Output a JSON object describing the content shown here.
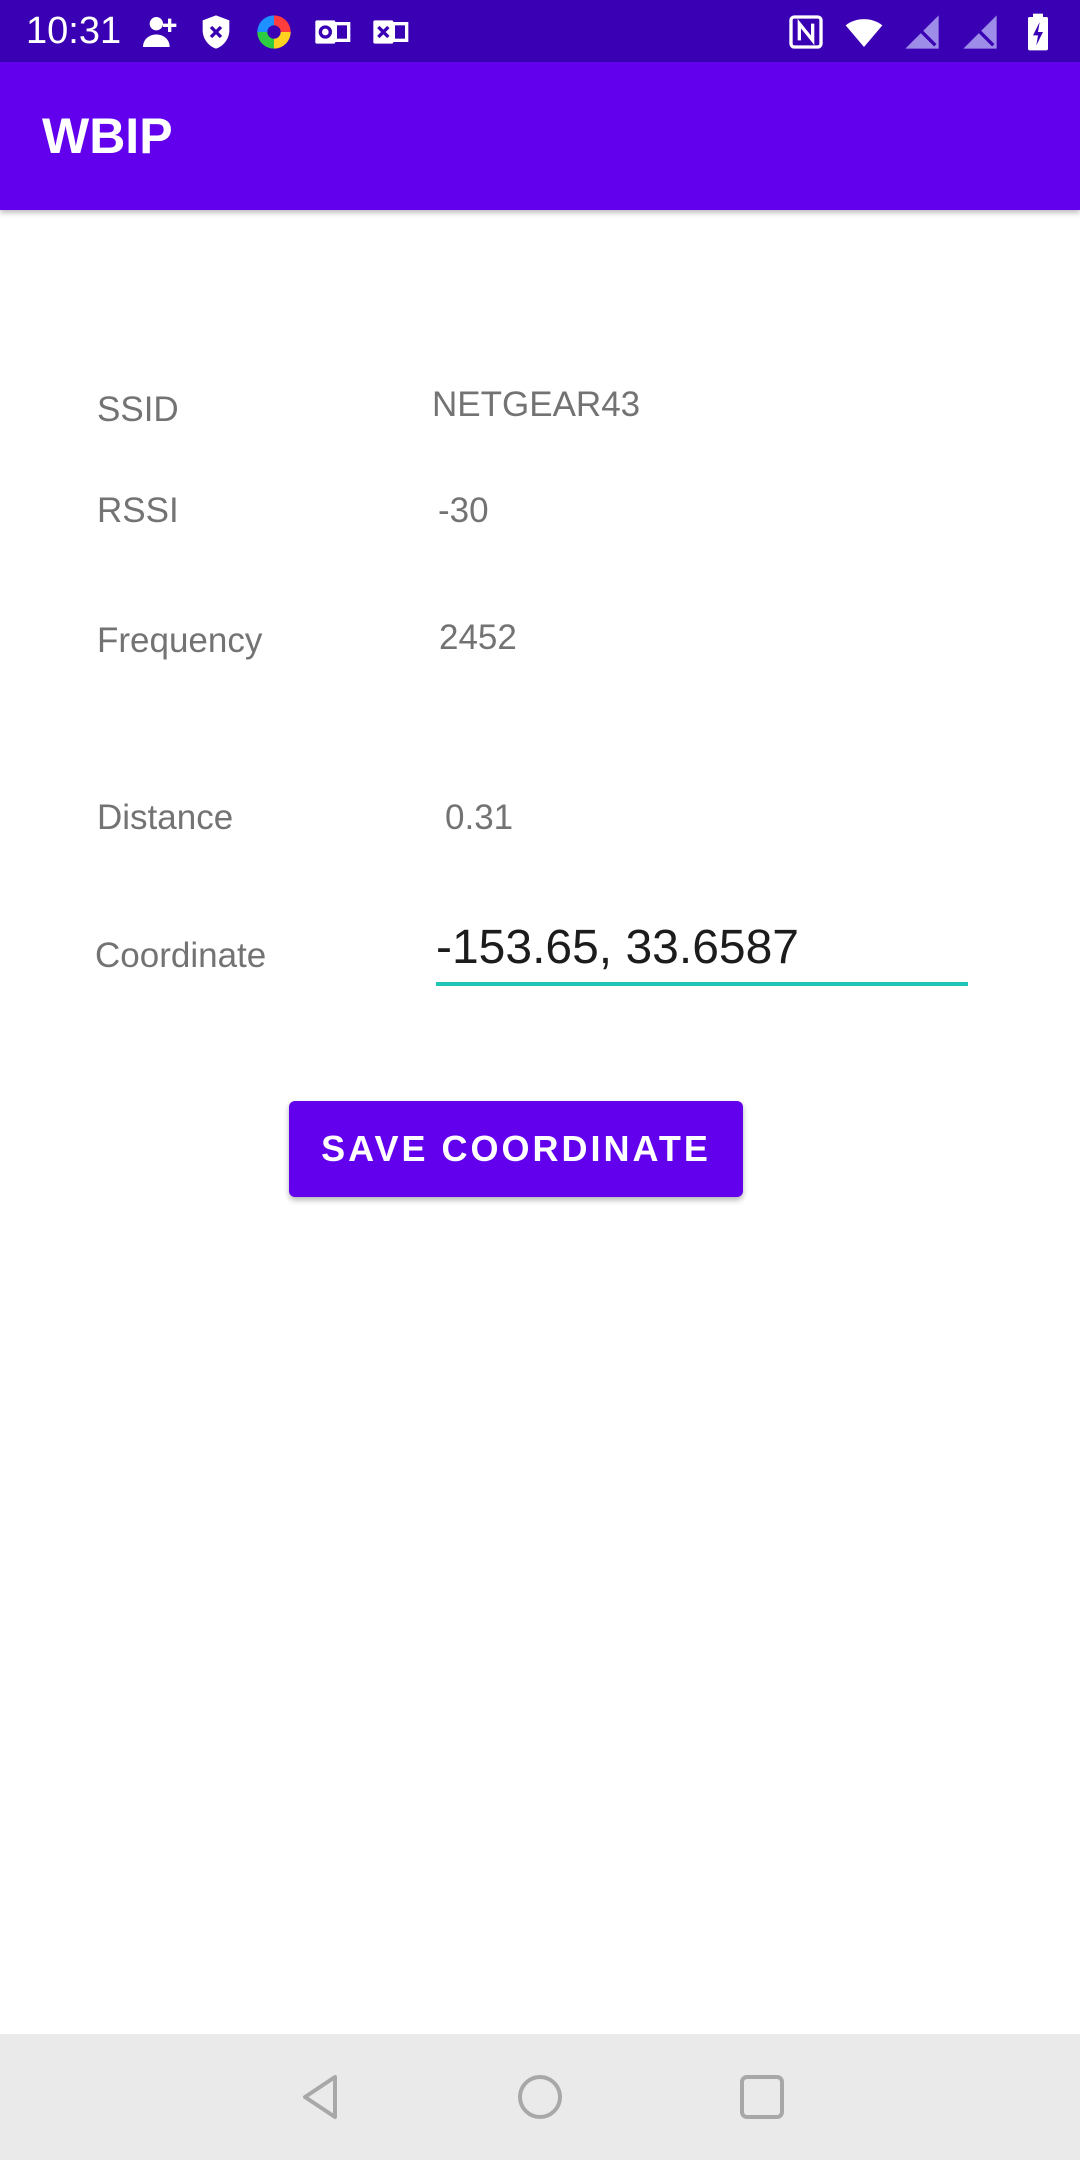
{
  "status_bar": {
    "time": "10:31",
    "left_icons": [
      "add-person-icon",
      "shield-icon",
      "color-wheel-icon",
      "outlook-icon",
      "mail-icon"
    ],
    "right_icons": [
      "nfc-icon",
      "wifi-icon",
      "no-signal-icon",
      "no-signal-icon",
      "battery-icon"
    ]
  },
  "app_bar": {
    "title": "WBIP",
    "color": "#6200ee"
  },
  "fields": {
    "ssid": {
      "label": "SSID",
      "value": "NETGEAR43"
    },
    "rssi": {
      "label": "RSSI",
      "value": "-30"
    },
    "frequency": {
      "label": "Frequency",
      "value": "2452"
    },
    "distance": {
      "label": "Distance",
      "value": "0.31"
    },
    "coordinate": {
      "label": "Coordinate",
      "value": "-153.65, 33.6587"
    }
  },
  "save_button": {
    "label": "SAVE COORDINATE"
  },
  "nav_bar": {
    "buttons": [
      "back-icon",
      "home-icon",
      "recents-icon"
    ]
  },
  "colors": {
    "accent": "#1fc6b8",
    "status_bar": "#3a00b3",
    "primary": "#6200ee"
  }
}
